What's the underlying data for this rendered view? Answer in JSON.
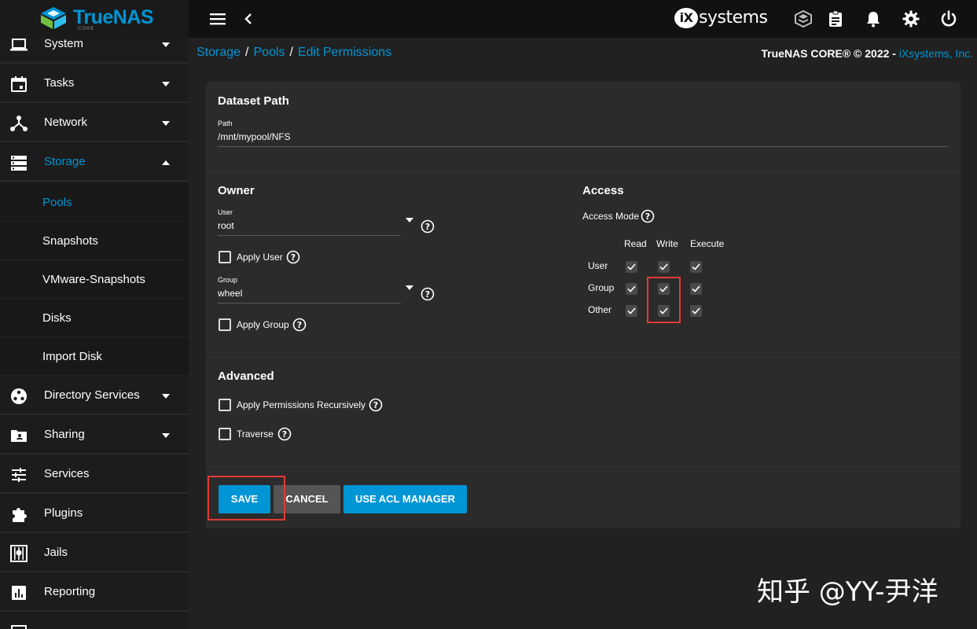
{
  "brand": {
    "name": "TrueNAS",
    "edition": "CORE",
    "vendor_logo": "iXsystems"
  },
  "topbar": {
    "icons": [
      "menu-icon",
      "back-icon",
      "truecommand-icon",
      "clipboard-icon",
      "bell-icon",
      "gear-icon",
      "power-icon"
    ]
  },
  "sidebar": {
    "items": [
      {
        "label": "System",
        "icon": "laptop-icon",
        "expandable": true
      },
      {
        "label": "Tasks",
        "icon": "calendar-icon",
        "expandable": true
      },
      {
        "label": "Network",
        "icon": "network-icon",
        "expandable": true
      },
      {
        "label": "Storage",
        "icon": "storage-icon",
        "expandable": true,
        "expanded": true,
        "active": true
      },
      {
        "label": "Directory Services",
        "icon": "directory-icon",
        "expandable": true
      },
      {
        "label": "Sharing",
        "icon": "folder-share-icon",
        "expandable": true
      },
      {
        "label": "Services",
        "icon": "tune-icon",
        "expandable": false
      },
      {
        "label": "Plugins",
        "icon": "puzzle-icon",
        "expandable": false
      },
      {
        "label": "Jails",
        "icon": "jail-icon",
        "expandable": false
      },
      {
        "label": "Reporting",
        "icon": "chart-icon",
        "expandable": false
      }
    ],
    "storage_children": [
      {
        "label": "Pools",
        "active": true
      },
      {
        "label": "Snapshots"
      },
      {
        "label": "VMware-Snapshots"
      },
      {
        "label": "Disks"
      },
      {
        "label": "Import Disk"
      }
    ]
  },
  "breadcrumb": {
    "items": [
      "Storage",
      "Pools",
      "Edit Permissions"
    ],
    "separator": "/"
  },
  "copyright": {
    "text": "TrueNAS CORE® © 2022 - ",
    "link": "iXsystems, Inc."
  },
  "dataset": {
    "title": "Dataset Path",
    "path_label": "Path",
    "path_value": "/mnt/mypool/NFS"
  },
  "owner": {
    "title": "Owner",
    "user_label": "User",
    "user_value": "root",
    "apply_user_label": "Apply User",
    "group_label": "Group",
    "group_value": "wheel",
    "apply_group_label": "Apply Group"
  },
  "access": {
    "title": "Access",
    "mode_label": "Access Mode",
    "columns": [
      "Read",
      "Write",
      "Execute"
    ],
    "rows": [
      {
        "label": "User",
        "read": true,
        "write": true,
        "execute": true
      },
      {
        "label": "Group",
        "read": true,
        "write": true,
        "execute": true
      },
      {
        "label": "Other",
        "read": true,
        "write": true,
        "execute": true
      }
    ]
  },
  "advanced": {
    "title": "Advanced",
    "recursive_label": "Apply Permissions Recursively",
    "traverse_label": "Traverse"
  },
  "actions": {
    "save": "SAVE",
    "cancel": "CANCEL",
    "acl": "USE ACL MANAGER"
  },
  "watermark": "知乎 @YY-尹洋",
  "colors": {
    "accent": "#0095d5",
    "highlight": "#e53935",
    "background": "#212121",
    "card": "#2b2b2b"
  }
}
